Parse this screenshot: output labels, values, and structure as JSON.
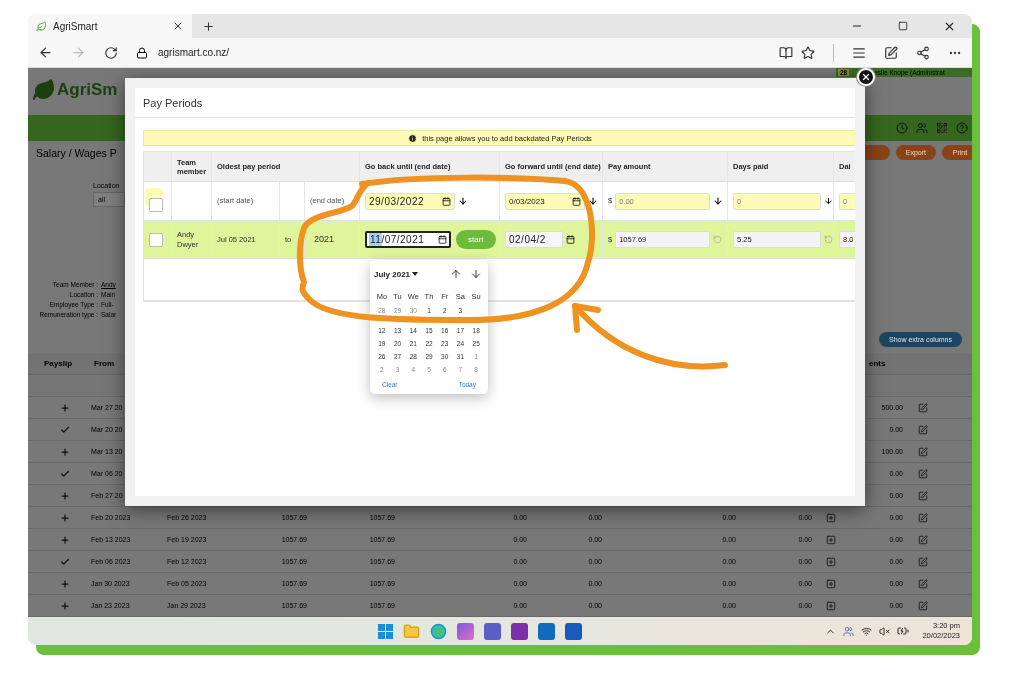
{
  "browser": {
    "tab_title": "AgriSmart",
    "address": "agrismart.co.nz/",
    "forward_disabled": true
  },
  "background_page": {
    "logo_text": "AgriSm",
    "user": {
      "badge": "28",
      "name": "eslie Knope (Administrat"
    },
    "page_title": "Salary / Wages P",
    "buttons": [
      "Export",
      "Print"
    ],
    "filter": {
      "label": "Location",
      "value": "all"
    },
    "details": [
      {
        "label": "Team Member :",
        "value": "Andy"
      },
      {
        "label": "Location :",
        "value": "Main"
      },
      {
        "label": "Employee Type :",
        "value": "Full-"
      },
      {
        "label": "Remuneration type :",
        "value": "Salar"
      }
    ],
    "show_extra_columns": "Show extra columns",
    "table": {
      "header_left": [
        "Payslip",
        "From"
      ],
      "header_right": "ents",
      "rows_behind_dialog": [
        {
          "kind": "plus",
          "from": "Mar 27 20",
          "amount": "500.00"
        },
        {
          "kind": "check",
          "from": "Mar 20 20",
          "amount": "0.00"
        },
        {
          "kind": "plus",
          "from": "Mar 13 20",
          "amount": "100.00"
        },
        {
          "kind": "check",
          "from": "Mar 06 20",
          "amount": "0.00"
        },
        {
          "kind": "plus",
          "from": "Feb 27 20",
          "amount": "0.00"
        }
      ],
      "rows": [
        {
          "kind": "plus",
          "from": "Feb 20 2023",
          "to": "Feb 26 2023",
          "cells": [
            "1057.69",
            "1057.69",
            "0.00",
            "0.00",
            "0.00",
            "0.00"
          ],
          "amount": "0.00"
        },
        {
          "kind": "plus",
          "from": "Feb 13 2023",
          "to": "Feb 19 2023",
          "cells": [
            "1057.69",
            "1057.69",
            "0.00",
            "0.00",
            "0.00",
            "0.00"
          ],
          "amount": "0.00"
        },
        {
          "kind": "check",
          "from": "Feb 06 2023",
          "to": "Feb 12 2023",
          "cells": [
            "1057.69",
            "1057.69",
            "0.00",
            "0.00",
            "0.00",
            "0.00"
          ],
          "amount": "0.00"
        },
        {
          "kind": "plus",
          "from": "Jan 30 2023",
          "to": "Feb 05 2023",
          "cells": [
            "1057.69",
            "1057.69",
            "0.00",
            "0.00",
            "0.00",
            "0.00"
          ],
          "amount": "0.00"
        },
        {
          "kind": "plus",
          "from": "Jan 23 2023",
          "to": "Jan 29 2023",
          "cells": [
            "1057.69",
            "1057.69",
            "0.00",
            "0.00",
            "0.00",
            "0.00"
          ],
          "amount": "0.00"
        }
      ]
    }
  },
  "dialog": {
    "title": "Pay Periods",
    "notice": "this page allows you to add backdated Pay Periods",
    "columns": [
      "Team member",
      "Oldest pay period",
      "Go back until (end date)",
      "Go forward until (end date)",
      "Pay amount",
      "Days paid",
      "Dai"
    ],
    "template_row": {
      "checked": false,
      "start_label": "(start date)",
      "end_label": "(end date)",
      "go_back": "29/03/2022",
      "go_forward": "0/03/2023",
      "currency": "$",
      "pay_amount_placeholder": "0.00",
      "days_paid_placeholder": "0",
      "extra_placeholder": "0"
    },
    "rows": [
      {
        "selected": true,
        "checked": false,
        "team_member": "Andy Dwyer",
        "oldest_from": "Jul 05 2021",
        "to": "to",
        "oldest_to": "2021",
        "go_back": "11/07/2021",
        "go_back_focused": true,
        "start_button": "start",
        "go_forward": "02/04/2",
        "currency": "$",
        "pay_amount": "1057.69",
        "days_paid": "5.25",
        "extra": "8.0"
      }
    ],
    "datepicker": {
      "month": "July 2021",
      "weekdays": [
        "Mo",
        "Tu",
        "We",
        "Th",
        "Fr",
        "Sa",
        "Su"
      ],
      "weeks": [
        [
          {
            "day": "28",
            "muted": true
          },
          {
            "day": "29",
            "muted": true
          },
          {
            "day": "30",
            "muted": true
          },
          {
            "day": "1",
            "muted": false
          },
          {
            "day": "2",
            "muted": false
          },
          {
            "day": "3",
            "muted": false
          }
        ],
        [
          {
            "day": "12",
            "muted": false
          },
          {
            "day": "13",
            "muted": false
          },
          {
            "day": "14",
            "muted": false
          },
          {
            "day": "15",
            "muted": false
          },
          {
            "day": "16",
            "muted": false
          },
          {
            "day": "17",
            "muted": false
          },
          {
            "day": "18",
            "muted": false
          }
        ],
        [
          {
            "day": "19",
            "muted": false
          },
          {
            "day": "20",
            "muted": false
          },
          {
            "day": "21",
            "muted": false
          },
          {
            "day": "22",
            "muted": false
          },
          {
            "day": "23",
            "muted": false
          },
          {
            "day": "24",
            "muted": false
          },
          {
            "day": "25",
            "muted": false
          }
        ],
        [
          {
            "day": "26",
            "muted": false
          },
          {
            "day": "27",
            "muted": false
          },
          {
            "day": "28",
            "muted": false
          },
          {
            "day": "29",
            "muted": false
          },
          {
            "day": "30",
            "muted": false
          },
          {
            "day": "31",
            "muted": false
          },
          {
            "day": "1",
            "muted": true
          }
        ],
        [
          {
            "day": "2",
            "muted": true
          },
          {
            "day": "3",
            "muted": true
          },
          {
            "day": "4",
            "muted": true
          },
          {
            "day": "5",
            "muted": true
          },
          {
            "day": "6",
            "muted": true
          },
          {
            "day": "7",
            "muted": true
          },
          {
            "day": "8",
            "muted": true
          }
        ]
      ],
      "clear": "Clear",
      "today": "Today"
    }
  },
  "taskbar": {
    "time": "3:20 pm",
    "date": "20/02/2023"
  }
}
